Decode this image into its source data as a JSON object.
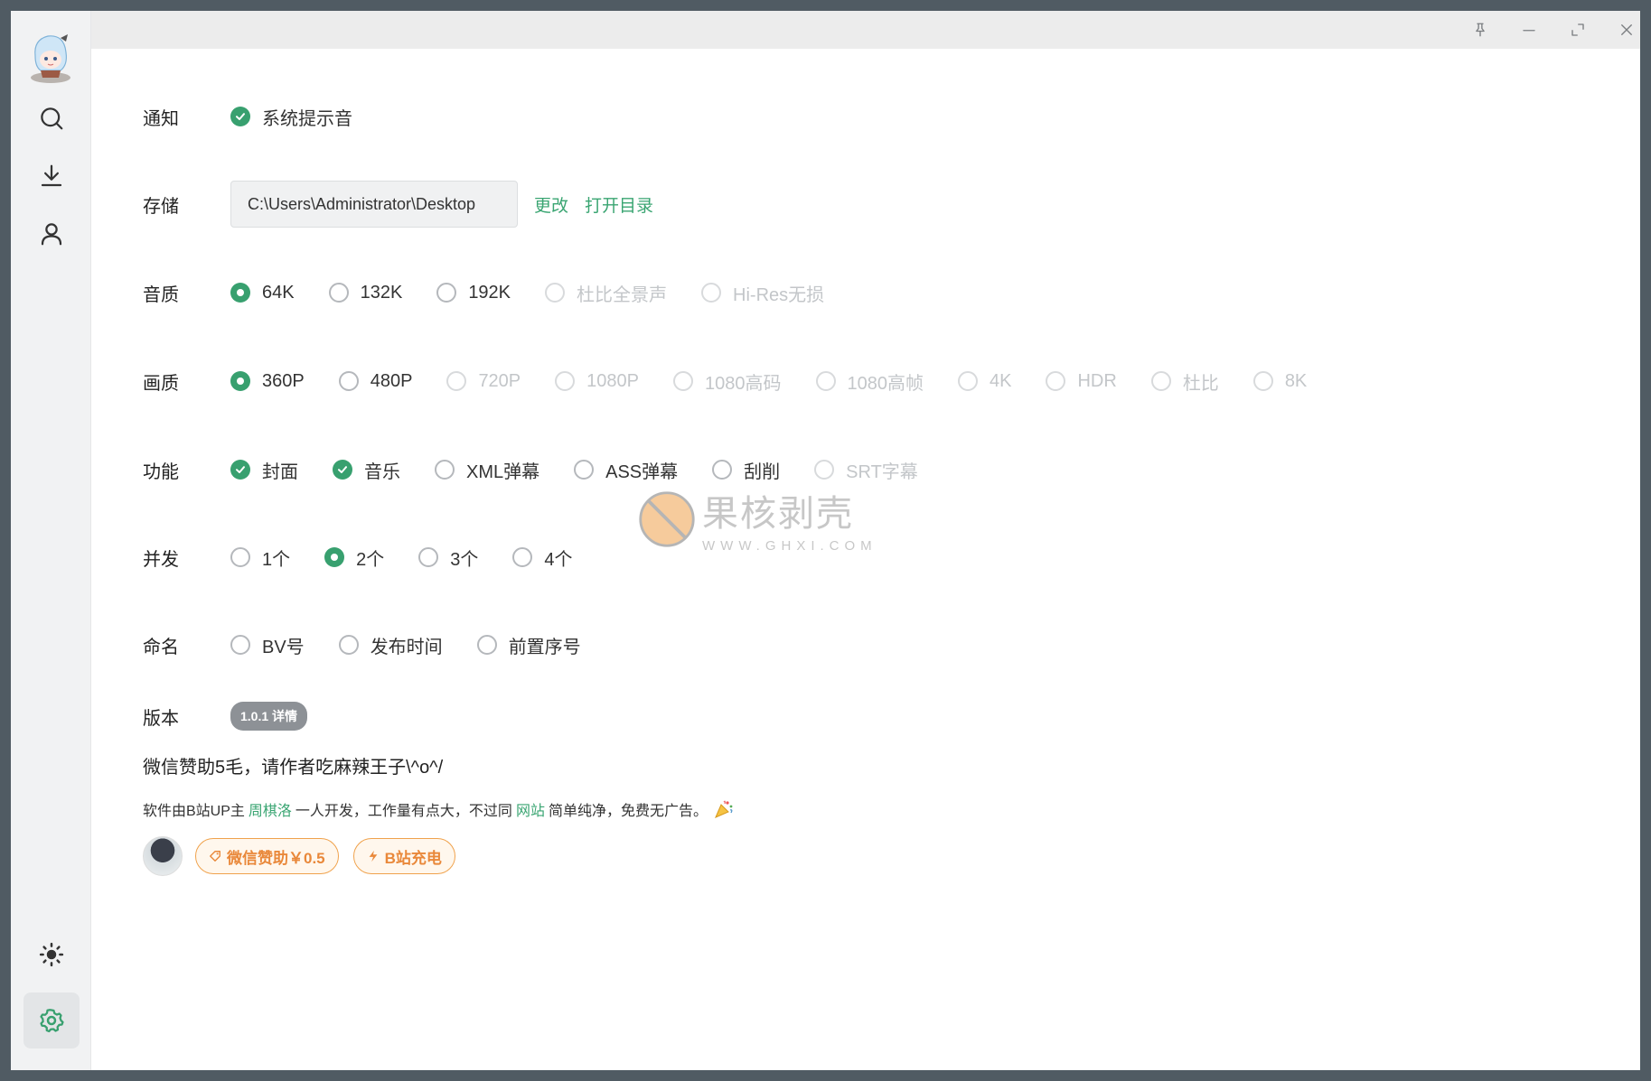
{
  "window_controls": {
    "pin": "pin-icon",
    "minimize": "minimize-icon",
    "maximize": "maximize-icon",
    "close": "close-icon"
  },
  "sidebar": {
    "items": [
      "search-icon",
      "download-icon",
      "user-icon",
      "theme-icon",
      "settings-icon"
    ],
    "active": "settings"
  },
  "settings": {
    "notify": {
      "label": "通知",
      "options": [
        {
          "text": "系统提示音",
          "checked": true
        }
      ]
    },
    "storage": {
      "label": "存储",
      "path": "C:\\Users\\Administrator\\Desktop",
      "change": "更改",
      "open": "打开目录"
    },
    "audio": {
      "label": "音质",
      "options": [
        "64K",
        "132K",
        "192K",
        "杜比全景声",
        "Hi-Res无损"
      ],
      "selected": "64K",
      "disabled": [
        "杜比全景声",
        "Hi-Res无损"
      ]
    },
    "video": {
      "label": "画质",
      "options": [
        "360P",
        "480P",
        "720P",
        "1080P",
        "1080高码",
        "1080高帧",
        "4K",
        "HDR",
        "杜比",
        "8K"
      ],
      "selected": "360P",
      "disabled": [
        "720P",
        "1080P",
        "1080高码",
        "1080高帧",
        "4K",
        "HDR",
        "杜比",
        "8K"
      ]
    },
    "features": {
      "label": "功能",
      "options": [
        "封面",
        "音乐",
        "XML弹幕",
        "ASS弹幕",
        "刮削",
        "SRT字幕"
      ],
      "checked": [
        "封面",
        "音乐"
      ],
      "disabled": [
        "SRT字幕"
      ]
    },
    "concurrency": {
      "label": "并发",
      "options": [
        "1个",
        "2个",
        "3个",
        "4个"
      ],
      "selected": "2个"
    },
    "naming": {
      "label": "命名",
      "options": [
        "BV号",
        "发布时间",
        "前置序号"
      ]
    },
    "version": {
      "label": "版本",
      "badge": "1.0.1 详情"
    }
  },
  "sponsor_text": "微信赞助5毛，请作者吃麻辣王子\\^o^/",
  "note": {
    "prefix": "软件由B站UP主",
    "author": "周棋洛",
    "middle": "一人开发，工作量有点大，不过同",
    "site": "网站",
    "suffix": "简单纯净，免费无广告。"
  },
  "buttons": {
    "wechat": "微信赞助￥0.5",
    "bilibili": "B站充电"
  },
  "watermark": {
    "title": "果核剥壳",
    "url": "WWW.GHXI.COM"
  },
  "colors": {
    "accent": "#38a06f",
    "link": "#3aa572",
    "orange": "#e9883a"
  }
}
